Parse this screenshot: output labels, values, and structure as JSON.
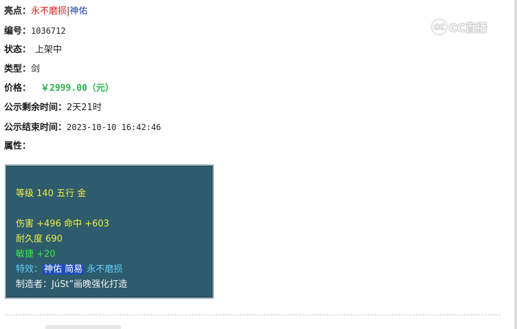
{
  "item": {
    "highlight_label": "亮点：",
    "highlight_a": "永不磨损",
    "highlight_sep": "|",
    "highlight_b": "神佑",
    "id_label": "编号：",
    "id_value": "1036712",
    "status_label": "状态：",
    "status_value": "上架中",
    "type_label": "类型：",
    "type_value": "剑",
    "price_label": "价格：",
    "price_value": "￥2999.00（元）",
    "remain_label": "公示剩余时间：",
    "remain_value": "2天21时",
    "end_label": "公示结束时间：",
    "end_value": "2023-10-10 16:42:46",
    "attr_label": "属性："
  },
  "attributes": {
    "level_line": "等级 140 五行 金",
    "damage_line": "伤害 +496 命中 +603",
    "durability_line": "耐久度 690",
    "agility_line": "敏捷 +20",
    "effect_prefix": "特效：",
    "effect_hl": "神佑 简易",
    "effect_rest": "永不磨损",
    "maker_line": "制造者：JúSt”画晚强化打造"
  },
  "watermark": {
    "circle": "CC",
    "text": "CC直播"
  },
  "colors": {
    "red": "#e0191c",
    "blue": "#1b3fa8",
    "price_green": "#2db34a",
    "panel_bg": "#2e5c6c",
    "attr_yellow": "#f2ee47",
    "attr_green": "#3ee34a",
    "attr_cyan": "#5fd0ff",
    "highlight": "#1f4fb8"
  }
}
